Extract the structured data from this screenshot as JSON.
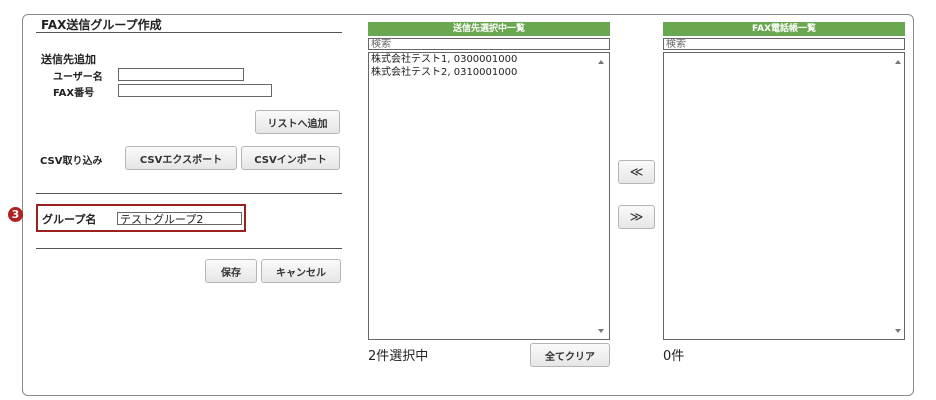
{
  "form": {
    "title": "FAX送信グループ作成",
    "section_add": "送信先追加",
    "user_label": "ユーザー名",
    "user_value": "",
    "fax_label": "FAX番号",
    "fax_value": "",
    "add_to_list_button": "リストへ追加",
    "csv_label": "CSV取り込み",
    "csv_export_button": "CSVエクスポート",
    "csv_import_button": "CSVインポート",
    "group_name_label": "グループ名",
    "group_name_value": "テストグループ2",
    "save_button": "保存",
    "cancel_button": "キャンセル",
    "step_badge": "3"
  },
  "selected_panel": {
    "header": "送信先選択中一覧",
    "search_placeholder": "検索",
    "items": [
      "株式会社テスト1, 0300001000",
      "株式会社テスト2, 0310001000"
    ],
    "count_text": "2件選択中",
    "clear_button": "全てクリア"
  },
  "phonebook_panel": {
    "header": "FAX電話帳一覧",
    "search_placeholder": "検索",
    "items": [],
    "count_text": "0件"
  },
  "move_buttons": {
    "left": "≪",
    "right": "≫"
  },
  "colors": {
    "header_green": "#6aa84f",
    "highlight_red": "#9b2020"
  }
}
